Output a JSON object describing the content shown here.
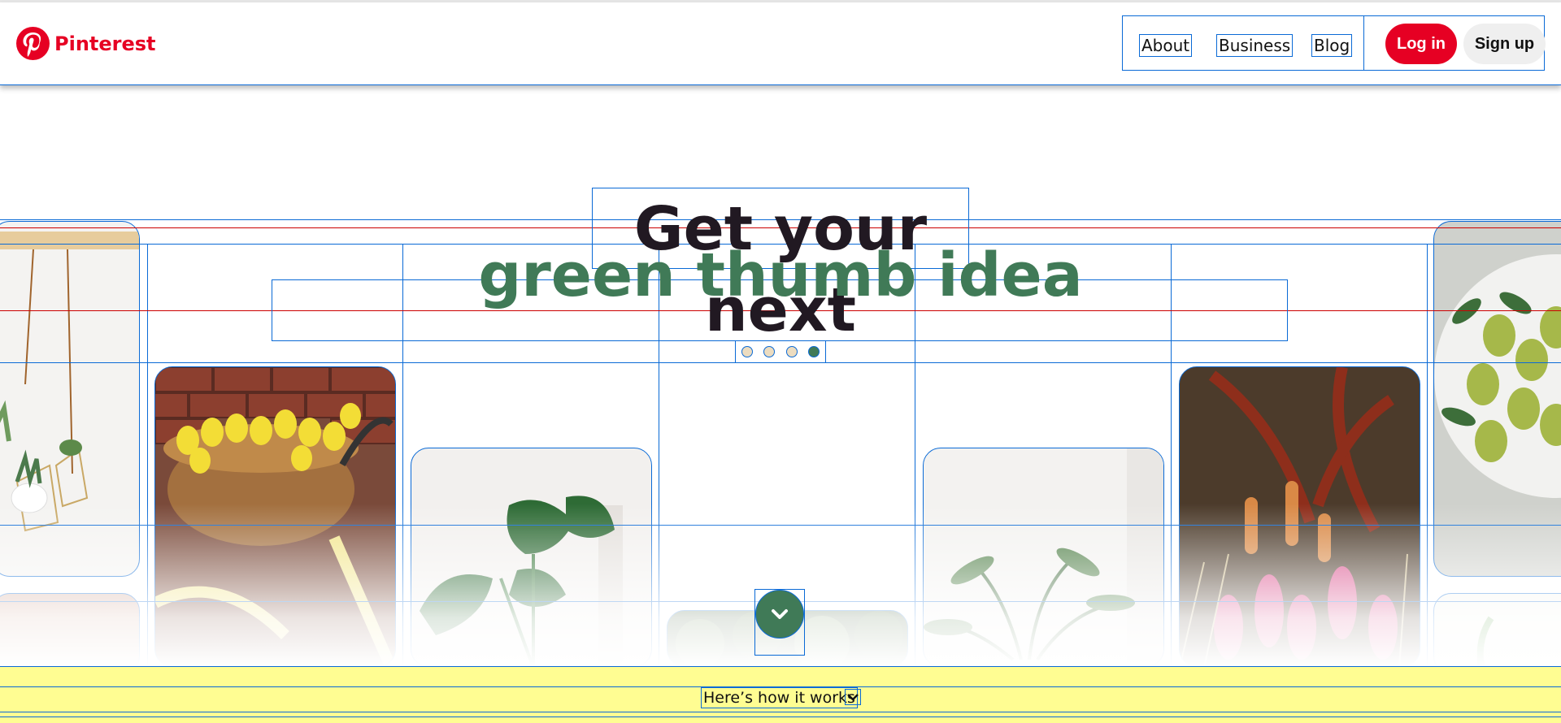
{
  "header": {
    "logo_text": "Pinterest",
    "nav": [
      "About",
      "Business",
      "Blog"
    ],
    "login_label": "Log in",
    "signup_label": "Sign up"
  },
  "hero": {
    "title": "Get your next",
    "subtitle": "green thumb idea",
    "carousel_dots": 4,
    "active_dot": 4
  },
  "tiles": [
    {
      "name": "hanging-planters-tile",
      "icon": "hanging-planter"
    },
    {
      "name": "tulip-bike-basket-tile",
      "icon": "tulip-basket"
    },
    {
      "name": "monstera-plant-tile",
      "icon": "monstera"
    },
    {
      "name": "leafy-greens-tile",
      "icon": "greens"
    },
    {
      "name": "palm-plant-tile",
      "icon": "palm"
    },
    {
      "name": "garden-flowers-tile",
      "icon": "flowers"
    },
    {
      "name": "pears-bowl-tile",
      "icon": "pears"
    }
  ],
  "footer": {
    "how_label": "Here’s how it works"
  },
  "colors": {
    "brand_red": "#e60023",
    "hero_green": "#407a57",
    "footer_yellow": "#fffd92"
  }
}
